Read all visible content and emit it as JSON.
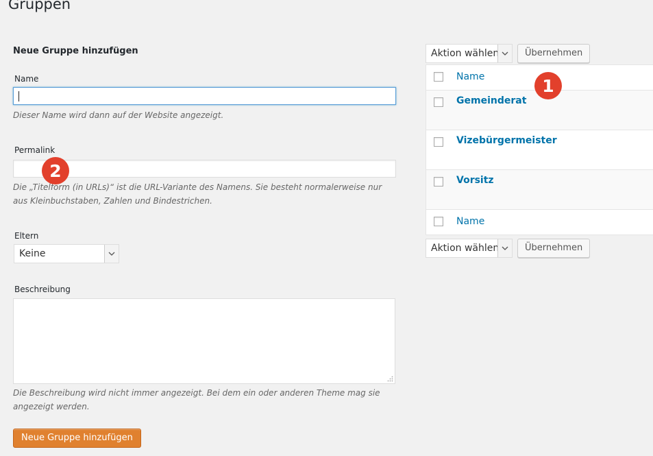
{
  "page": {
    "title": "Gruppen"
  },
  "form": {
    "heading": "Neue Gruppe hinzufügen",
    "name": {
      "label": "Name",
      "value": "",
      "help": "Dieser Name wird dann auf der Website angezeigt."
    },
    "slug": {
      "label": "Permalink",
      "value": "",
      "help": "Die „Titelform (in URLs)“ ist die URL-Variante des Namens. Sie besteht normalerweise nur aus Kleinbuchstaben, Zahlen und Bindestrichen."
    },
    "parent": {
      "label": "Eltern",
      "selected": "Keine"
    },
    "description": {
      "label": "Beschreibung",
      "value": "",
      "help": "Die Beschreibung wird nicht immer angezeigt. Bei dem ein oder anderen Theme mag sie angezeigt werden."
    },
    "submit_label": "Neue Gruppe hinzufügen"
  },
  "bulk_actions": {
    "top": {
      "selected": "Aktion wählen",
      "apply_label": "Übernehmen"
    },
    "bottom": {
      "selected": "Aktion wählen",
      "apply_label": "Übernehmen"
    }
  },
  "table": {
    "column_header": "Name",
    "column_footer": "Name",
    "rows": [
      {
        "name": "Gemeinderat"
      },
      {
        "name": "Vizebürgermeister"
      },
      {
        "name": "Vorsitz"
      }
    ]
  },
  "markers": {
    "one": "1",
    "two": "2"
  },
  "colors": {
    "accent": "#0073aa",
    "primary_button": "#e0812f",
    "marker": "#e2402c"
  }
}
